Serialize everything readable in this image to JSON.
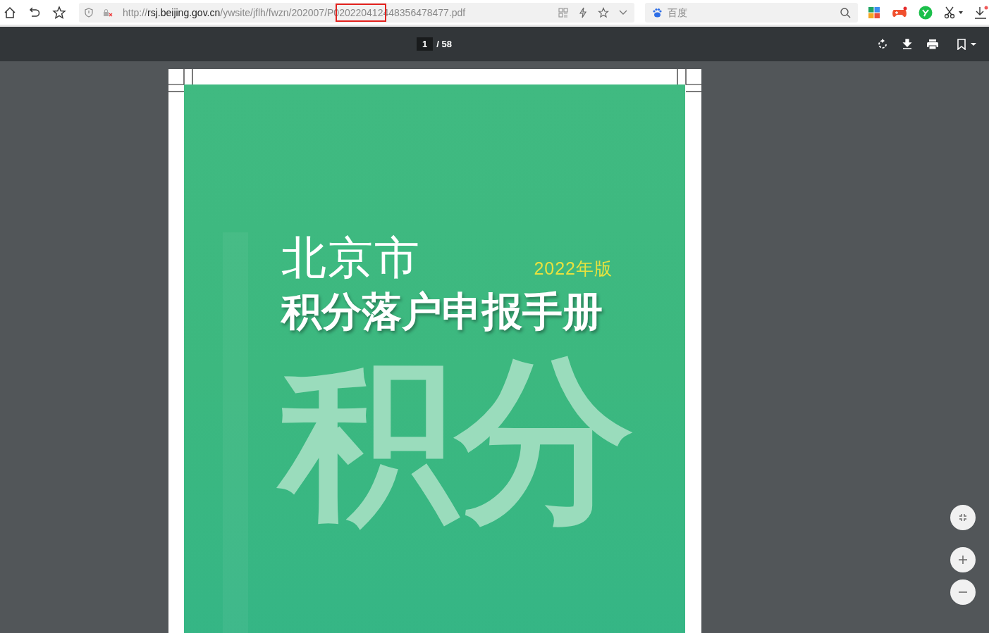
{
  "browser": {
    "url_parts": [
      {
        "text": "http://",
        "emphasis": false,
        "highlighted": false
      },
      {
        "text": "rsj.beijing.gov.cn",
        "emphasis": true,
        "highlighted": false
      },
      {
        "text": "/ywsite/jflh/fwzn/202007/P0",
        "emphasis": false,
        "highlighted": false
      },
      {
        "text": "20220412",
        "emphasis": false,
        "highlighted": true
      },
      {
        "text": "448356478477.pdf",
        "emphasis": false,
        "highlighted": false
      }
    ],
    "search": {
      "placeholder": "百度"
    }
  },
  "pdf_toolbar": {
    "page_number": "1",
    "page_total": "/ 58"
  },
  "document": {
    "city": "北京市",
    "edition": "2022年版",
    "title": "积分落户申报手册",
    "watermark_lines": [
      "积分"
    ]
  }
}
